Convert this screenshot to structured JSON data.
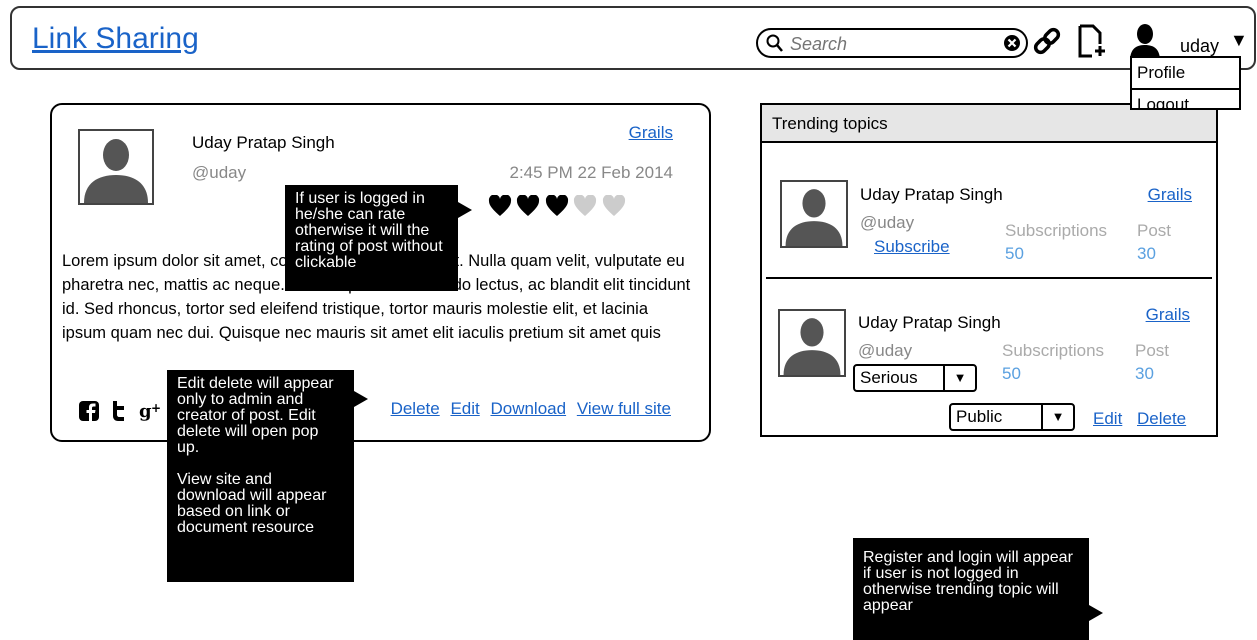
{
  "header": {
    "title": "Link Sharing",
    "search_placeholder": "Search",
    "user_name": "uday",
    "user_caret": "▼",
    "dropdown": {
      "profile": "Profile",
      "logout": "Logout"
    }
  },
  "post": {
    "author_name": "Uday Pratap Singh",
    "author_handle": "@uday",
    "topic": "Grails",
    "timestamp": "2:45 PM 22 Feb 2014",
    "rating": {
      "value": 3,
      "max": 5
    },
    "body": "Lorem ipsum dolor sit amet, consectetur adipiscing elit. Nulla quam velit, vulputate eu pharetra nec, mattis ac neque. Duis vulputate commodo lectus, ac blandit elit tincidunt id. Sed rhoncus, tortor sed eleifend tristique, tortor mauris molestie elit, et lacinia ipsum quam nec dui. Quisque nec mauris sit amet elit iaculis pretium sit amet quis",
    "actions": {
      "delete": "Delete",
      "edit": "Edit",
      "download": "Download",
      "view_full_site": "View full site"
    }
  },
  "tooltips": {
    "rating": "If user is logged in he/she can rate otherwise it will the rating of post without clickable",
    "actions_1": "Edit delete will appear only to admin and creator of post. Edit delete will open pop up.",
    "actions_2": "View site and download will appear based on link or document resource",
    "trending": "Register and login will appear if user is not logged in otherwise trending topic will appear"
  },
  "trending": {
    "title": "Trending topics",
    "items": [
      {
        "author_name": "Uday Pratap Singh",
        "author_handle": "@uday",
        "topic": "Grails",
        "subscriptions_label": "Subscriptions",
        "subscriptions": "50",
        "post_label": "Post",
        "posts": "30",
        "subscribe_label": "Subscribe"
      },
      {
        "author_name": "Uday Pratap Singh",
        "author_handle": "@uday",
        "topic": "Grails",
        "subscriptions_label": "Subscriptions",
        "subscriptions": "50",
        "post_label": "Post",
        "posts": "30",
        "seriousness": "Serious",
        "visibility": "Public",
        "edit_label": "Edit",
        "delete_label": "Delete"
      }
    ]
  },
  "icons": {
    "search": "search-icon",
    "clear": "clear-icon",
    "link": "link-icon",
    "document": "new-document-icon",
    "user": "user-icon",
    "avatar": "avatar-silhouette-icon",
    "heart": "heart-icon",
    "facebook": "facebook-icon",
    "twitter": "twitter-icon",
    "google_plus": "google-plus-icon"
  },
  "colors": {
    "link": "#1a63c8",
    "muted": "#888888",
    "stat_number": "#5aa0e0",
    "heart_on": "#000000",
    "heart_off": "#cccccc"
  }
}
